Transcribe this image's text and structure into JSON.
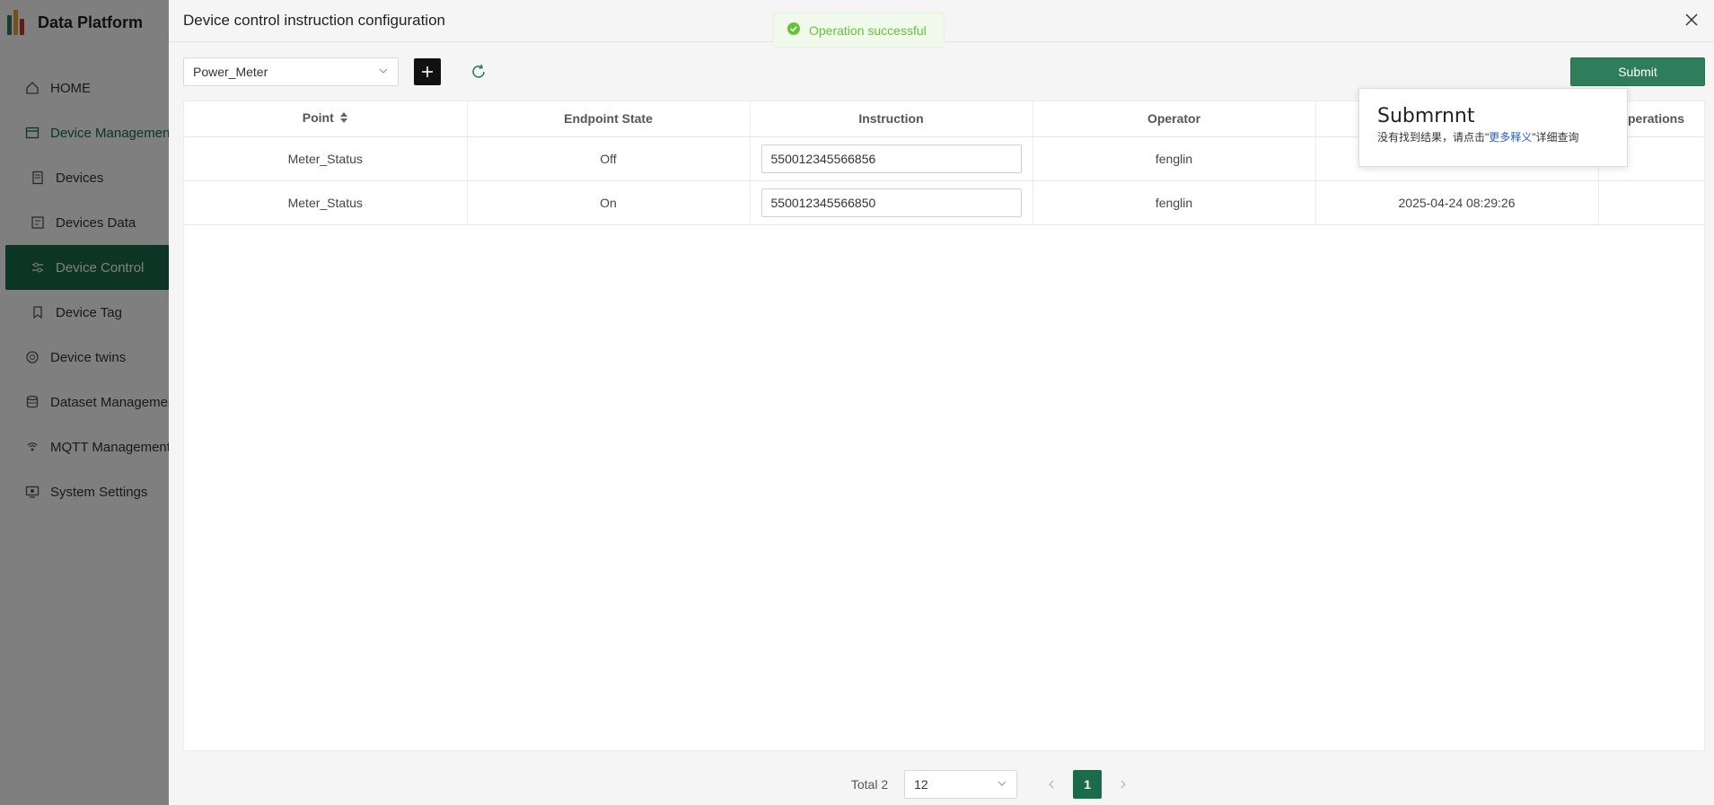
{
  "app": {
    "brand_title": "Data Platform"
  },
  "sidebar": {
    "items": [
      {
        "label": "HOME",
        "icon": "home-icon"
      },
      {
        "label": "Device Management",
        "icon": "device-management-icon"
      },
      {
        "label": "Devices",
        "icon": "devices-icon"
      },
      {
        "label": "Devices Data",
        "icon": "devices-data-icon"
      },
      {
        "label": "Device Control",
        "icon": "device-control-icon"
      },
      {
        "label": "Device Tag",
        "icon": "device-tag-icon"
      },
      {
        "label": "Device twins",
        "icon": "device-twins-icon"
      },
      {
        "label": "Dataset Management",
        "icon": "dataset-icon"
      },
      {
        "label": "MQTT Management",
        "icon": "mqtt-icon"
      },
      {
        "label": "System Settings",
        "icon": "settings-icon"
      }
    ]
  },
  "drawer": {
    "title": "Device control instruction configuration",
    "device_select": "Power_Meter",
    "submit_label": "Submit"
  },
  "toast": {
    "message": "Operation successful"
  },
  "popover": {
    "title": "Submrnnt",
    "text_before": "没有找到结果，请点击\"",
    "link": "更多释义",
    "text_after": "\"详细查询"
  },
  "table": {
    "headers": [
      "Point",
      "Endpoint State",
      "Instruction",
      "Operator",
      "",
      "Operations"
    ],
    "rows": [
      {
        "point": "Meter_Status",
        "state": "Off",
        "instruction": "550012345566856",
        "operator": "fenglin",
        "time": ""
      },
      {
        "point": "Meter_Status",
        "state": "On",
        "instruction": "550012345566850",
        "operator": "fenglin",
        "time": "2025-04-24 08:29:26"
      }
    ]
  },
  "pagination": {
    "total": "Total 2",
    "page_size": "12",
    "current_page": "1"
  },
  "colors": {
    "accent": "#1a6b4a",
    "submit": "#2e7d5b",
    "success": "#67c23a"
  }
}
